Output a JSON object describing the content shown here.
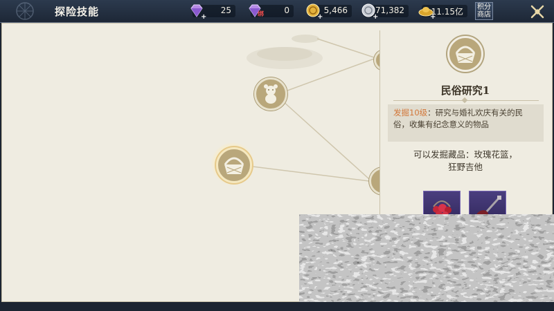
{
  "header": {
    "title": "探险技能",
    "shop_label_1": "积分",
    "shop_label_2": "商店"
  },
  "currencies": [
    {
      "name": "diamond",
      "value": "25",
      "icon": "purple-diamond-icon"
    },
    {
      "name": "bound-diamond",
      "value": "0",
      "icon": "bound-diamond-icon",
      "badge": "绑"
    },
    {
      "name": "gold-coin",
      "value": "5,466",
      "icon": "gold-coin-icon"
    },
    {
      "name": "silver-coin",
      "value": "71,382",
      "icon": "silver-coin-icon"
    },
    {
      "name": "gold-ingot",
      "value": "11.15亿",
      "icon": "gold-ingot-icon"
    }
  ],
  "skill_tree": {
    "nodes": [
      {
        "name": "teddy-bear",
        "icon": "teddy-bear-icon",
        "selected": false
      },
      {
        "name": "basket",
        "icon": "basket-icon",
        "selected": true
      },
      {
        "name": "right-edge-node-top",
        "icon": "node-icon",
        "selected": false
      },
      {
        "name": "right-edge-node-bottom",
        "icon": "node-icon",
        "selected": false
      }
    ]
  },
  "detail": {
    "icon": "basket-icon",
    "title": "民俗研究1",
    "level": "发掘10级",
    "description": "：研究与婚礼欢庆有关的民俗，收集有纪念意义的物品",
    "loot_line1": "可以发掘藏品：玫瑰花篮，",
    "loot_line2": "狂野吉他",
    "items": [
      {
        "name": "玫瑰花篮",
        "icon": "rose-basket-icon"
      },
      {
        "name": "狂野吉他",
        "icon": "guitar-icon"
      }
    ]
  },
  "colors": {
    "topbar": "#2c3a4e",
    "panel": "#efece1",
    "node": "#b9a77b",
    "level_text": "#d2773a",
    "item_bg": "#4a3e7e"
  }
}
